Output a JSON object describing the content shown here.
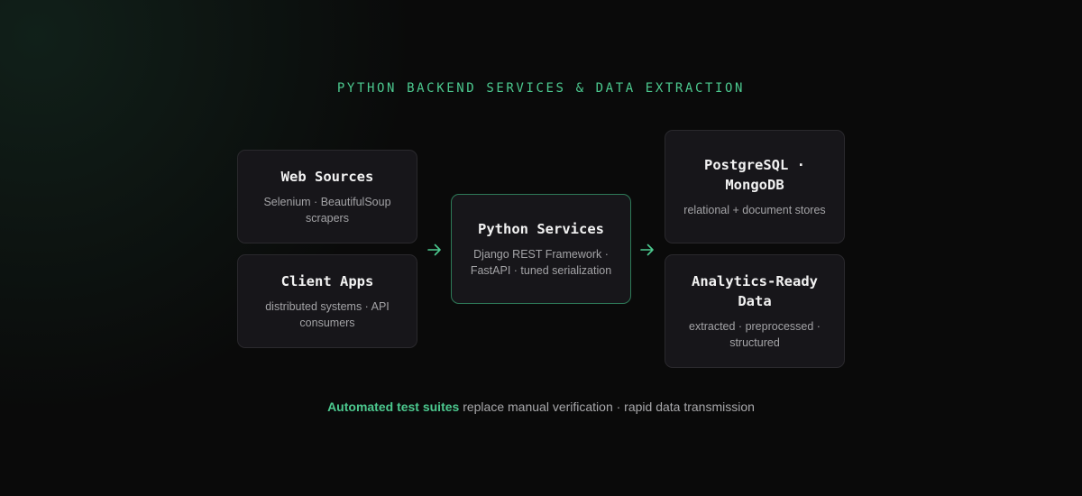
{
  "title": "PYTHON BACKEND SERVICES & DATA EXTRACTION",
  "nodes": {
    "web_sources": {
      "title": "Web Sources",
      "subtitle": "Selenium · BeautifulSoup scrapers"
    },
    "client_apps": {
      "title": "Client Apps",
      "subtitle": "distributed systems · API consumers"
    },
    "python_services": {
      "title": "Python Services",
      "subtitle": "Django REST Framework · FastAPI · tuned serialization"
    },
    "databases": {
      "title": "PostgreSQL · MongoDB",
      "subtitle": "relational + document stores"
    },
    "analytics": {
      "title": "Analytics-Ready Data",
      "subtitle": "extracted · preprocessed · structured"
    }
  },
  "footer": {
    "highlight": "Automated test suites",
    "rest": " replace manual verification · rapid data transmission"
  },
  "colors": {
    "accent": "#4cc98f",
    "background": "#0a0a0a",
    "card": "#17161a",
    "card_border": "#2a292d",
    "center_border": "#2e7a58"
  },
  "icons": {
    "arrow": "arrow-right-icon"
  }
}
